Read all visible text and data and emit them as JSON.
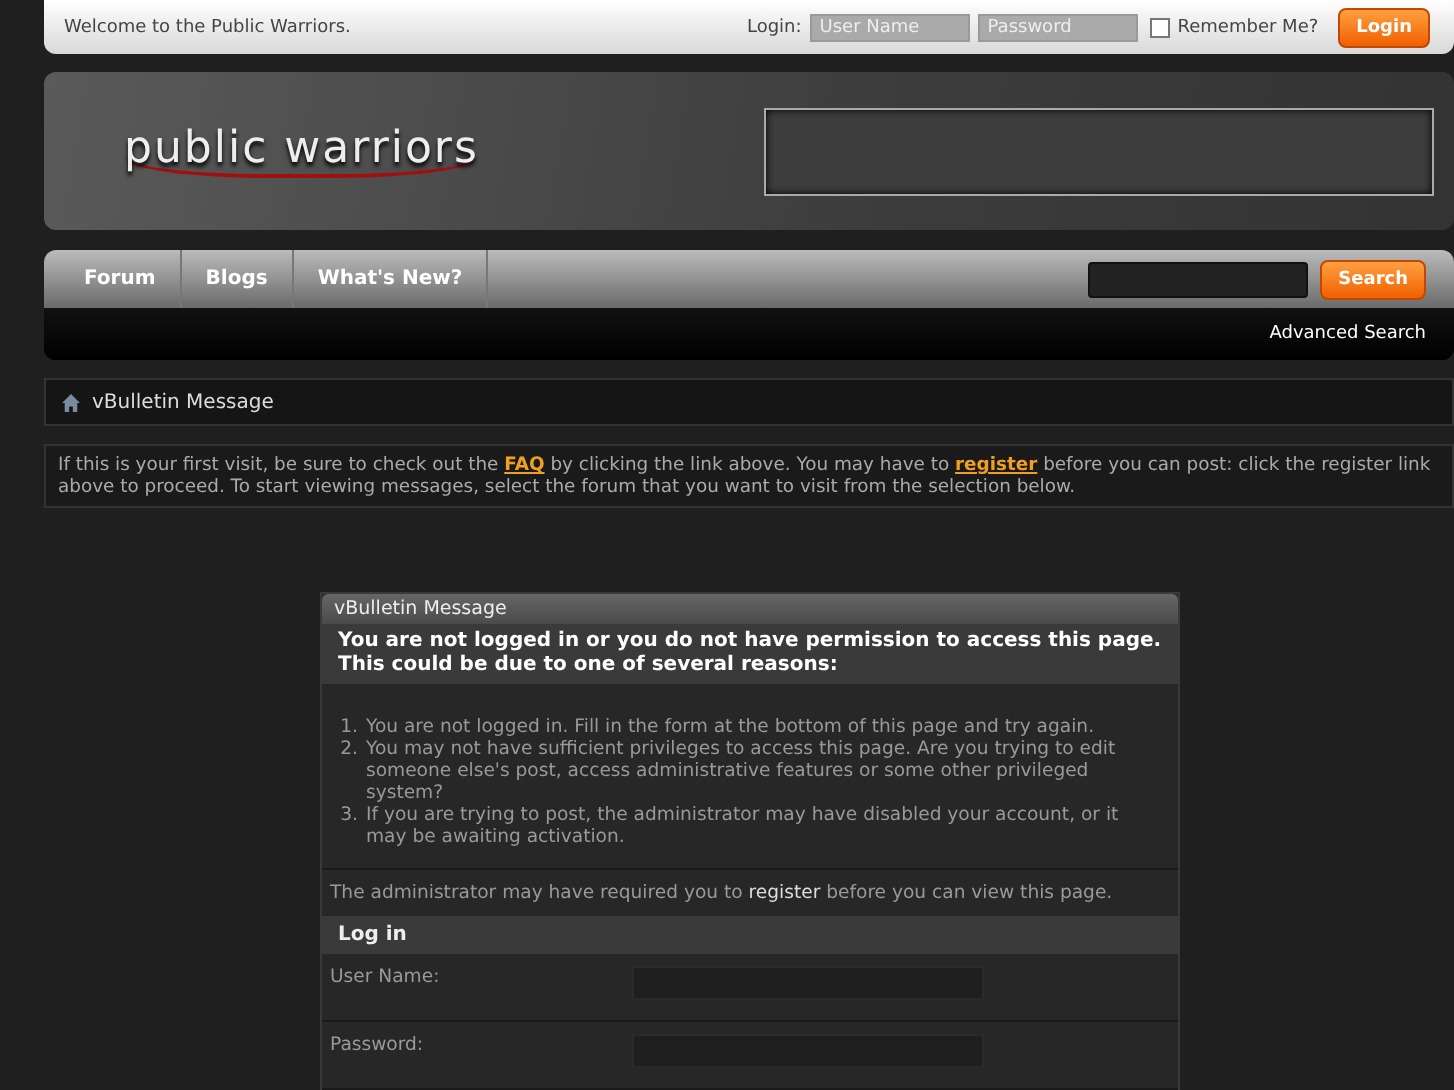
{
  "top_bar": {
    "welcome": "Welcome to the Public Warriors.",
    "login_label": "Login:",
    "username": {
      "placeholder": "User Name"
    },
    "password": {
      "placeholder": "Password"
    },
    "remember": {
      "label": "Remember Me?",
      "checked": false
    },
    "login_button": "Login"
  },
  "header": {
    "logo": "public warriors"
  },
  "nav": {
    "tabs": [
      {
        "label": "Forum",
        "selected": false
      },
      {
        "label": "Blogs",
        "selected": false
      },
      {
        "label": "What's New?",
        "selected": false
      }
    ],
    "search_button": "Search",
    "advanced_search": "Advanced Search"
  },
  "breadcrumb": {
    "title": "vBulletin Message"
  },
  "notice": {
    "before_faq": "If this is your first visit, be sure to check out the ",
    "faq": "FAQ",
    "middle": " by clicking the link above. You may have to ",
    "register": "register",
    "after": " before you can post: click the register link above to proceed. To start viewing messages, select the forum that you want to visit from the selection below."
  },
  "message": {
    "title": "vBulletin Message",
    "heading": "You are not logged in or you do not have permission to access this page. This could be due to one of several reasons:",
    "reasons": [
      {
        "number": "1.",
        "text": "You are not logged in. Fill in the form at the bottom of this page and try again."
      },
      {
        "number": "2.",
        "text": "You may not have sufficient privileges to access this page. Are you trying to edit someone else's post, access administrative features or some other privileged system?"
      },
      {
        "number": "3.",
        "text": "If you are trying to post, the administrator may have disabled your account, or it may be awaiting activation."
      }
    ],
    "note_before": "The administrator may have required you to ",
    "note_link": "register",
    "note_after": " before you can view this page.",
    "login_title": "Log in",
    "fields": [
      {
        "label": "User Name:"
      },
      {
        "label": "Password:"
      }
    ]
  }
}
